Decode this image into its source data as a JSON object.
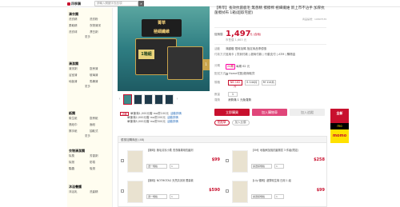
{
  "header": {
    "logo_text": "四季購",
    "search_placeholder": "請輸入關鍵字查品項",
    "search_icon": "search-icon"
  },
  "sidebar": {
    "sections": [
      {
        "title": "清衣類",
        "items": [
          "洗衣精",
          "洗衣粉",
          "柔軟精",
          "衣物清潔",
          "洗衣球",
          "漂白劑"
        ],
        "more": "更多"
      },
      {
        "title": "清潔類",
        "items": [
          "清潔劑",
          "廚房清",
          "浴室清",
          "玻璃清",
          "地板清",
          "馬桶清"
        ],
        "more": "更多"
      },
      {
        "title": "紙類",
        "items": [
          "衛生紙",
          "廚房紙",
          "濕紙巾",
          "面紙",
          "擦手紙",
          "抽取式"
        ],
        "more": "更多"
      },
      {
        "title": "衣物清潔類",
        "items": [
          "除臭",
          "芳香劑",
          "除濕",
          "防霉",
          "驅蟲",
          "吸濕"
        ],
        "more": ""
      },
      {
        "title": "沐浴養護",
        "items": [
          "沐浴乳",
          "洗髮精"
        ],
        "more": ""
      }
    ]
  },
  "product": {
    "brand": "菁萃",
    "title": "【菁萃】長效抗菌鹿毛 無香精 擦擦棉 極細纖維 新上市不沾手 加厚抗菌擦拭布 1箱(超取宅配)",
    "code": "商品編號：10897535",
    "price_label": "促銷價",
    "price": "1,497",
    "price_unit": "元 (含稅)",
    "price_note": "市售價 1,663 元",
    "promo_label": "活動",
    "promo_text": "滿額贈 限時加碼 指定商品享優惠",
    "pay_label": "付款方式",
    "pay_text": "信用卡 | 貨到付款 | 超商付款 | 行動支付 | ATM | 購物金",
    "install_label": "分期",
    "install_text": "24期",
    "install_note": "每期 62 元",
    "delivery_label": "配送方式",
    "delivery_text": "Home宅配/超商取貨",
    "spec_label": "規格",
    "specs": [
      "NB 162片",
      "S 144片",
      "M 114片"
    ],
    "qty_label": "數量",
    "qty_value": "1",
    "ship_label": "運費",
    "ship_text": "消費滿 1 元免運費",
    "buy_label": "立即購買",
    "cart_label": "加入購物車",
    "track_label": "加入追蹤",
    "share_label": "點點擊",
    "compare_label": "加入比價"
  },
  "gallery": {
    "badge_top": "菁萃",
    "badge_main": "極細纖維",
    "pack_label": "1箱組",
    "side_tag": "1",
    "thumb_count": 5
  },
  "promos": [
    {
      "tag": "活動",
      "text": "單筆滿1,000元贈 mo幣100元",
      "link": "活動詳情"
    },
    {
      "tag": "",
      "text": "單筆滿2,000元贈 mo幣200元",
      "link": "活動詳情"
    },
    {
      "tag": "",
      "text": "單筆滿5,000元贈 mo幣500元",
      "link": "活動詳情"
    }
  ],
  "ad": {
    "top_text": "全新",
    "mid_text": "mo",
    "bottom_text": "momo"
  },
  "recommended": {
    "title": "優惠加購商品 (48)",
    "items": [
      {
        "name": "【靜岡】無毛清潔小柔 洗衣機專用抗菌劑",
        "opt1": "選一規格",
        "opt2": "1",
        "price": "$99"
      },
      {
        "name": "【3M】地板刷加強抗菌擦拭 3 件組(限定)",
        "opt1": "請選擇規格",
        "opt2": "1",
        "price": "$258"
      },
      {
        "name": "【靜岡】NOTMOTAG 天然清潔劑 限量款",
        "opt1": "選一規格",
        "opt2": "1",
        "price": "$590"
      },
      {
        "name": "【Lily 蝶莉】超薄衛生棉 日用 1 組",
        "opt1": "請選擇規格",
        "opt2": "1",
        "price": "$99"
      }
    ]
  }
}
